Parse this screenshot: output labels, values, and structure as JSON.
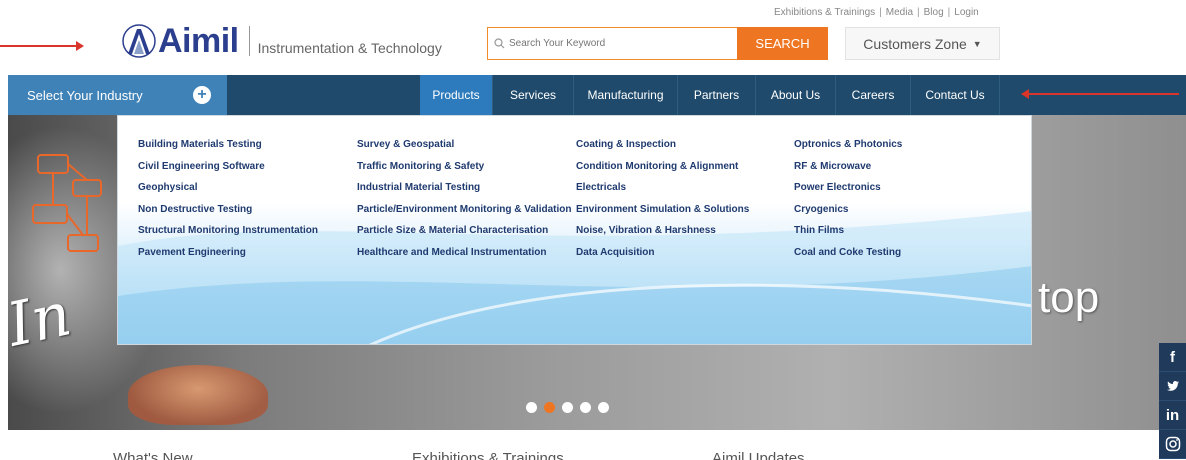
{
  "top_links": [
    "Exhibitions & Trainings",
    "Media",
    "Blog",
    "Login"
  ],
  "logo": {
    "name": "Aimil",
    "tagline": "Instrumentation & Technology"
  },
  "search": {
    "placeholder": "Search Your Keyword",
    "button_label": "SEARCH"
  },
  "customers_zone": {
    "label": "Customers Zone"
  },
  "industry": {
    "label": "Select Your Industry"
  },
  "nav": [
    "Products",
    "Services",
    "Manufacturing",
    "Partners",
    "About Us",
    "Careers",
    "Contact Us"
  ],
  "mega_menu": {
    "col1": [
      "Building Materials Testing",
      "Civil Engineering Software",
      "Geophysical",
      "Non Destructive Testing",
      "Structural Monitoring Instrumentation",
      "Pavement Engineering"
    ],
    "col2": [
      "Survey & Geospatial",
      "Traffic Monitoring & Safety",
      "Industrial Material Testing",
      "Particle/Environment Monitoring & Validation",
      "Particle Size & Material Characterisation",
      "Healthcare and Medical Instrumentation"
    ],
    "col3": [
      "Coating & Inspection",
      "Condition Monitoring & Alignment",
      "Electricals",
      "Environment Simulation & Solutions",
      "Noise, Vibration & Harshness",
      "Data Acquisition"
    ],
    "col4": [
      "Optronics & Photonics",
      "RF & Microwave",
      "Power Electronics",
      "Cryogenics",
      "Thin Films",
      "Coal and Coke Testing"
    ]
  },
  "hero": {
    "scribble_text": "In",
    "right_text": "top"
  },
  "slider": {
    "count": 5,
    "active_index": 1
  },
  "social": [
    "f",
    "in"
  ],
  "bottom": [
    "What's New",
    "Exhibitions & Trainings",
    "Aimil Updates"
  ],
  "colors": {
    "brand_navy": "#2b3f8e",
    "nav_bg": "#1f4a6b",
    "nav_active": "#2d7bbd",
    "industry_bg": "#3f82b8",
    "accent_orange": "#ee7623",
    "arrow_red": "#d9352b",
    "menu_text": "#1f3a6f"
  }
}
